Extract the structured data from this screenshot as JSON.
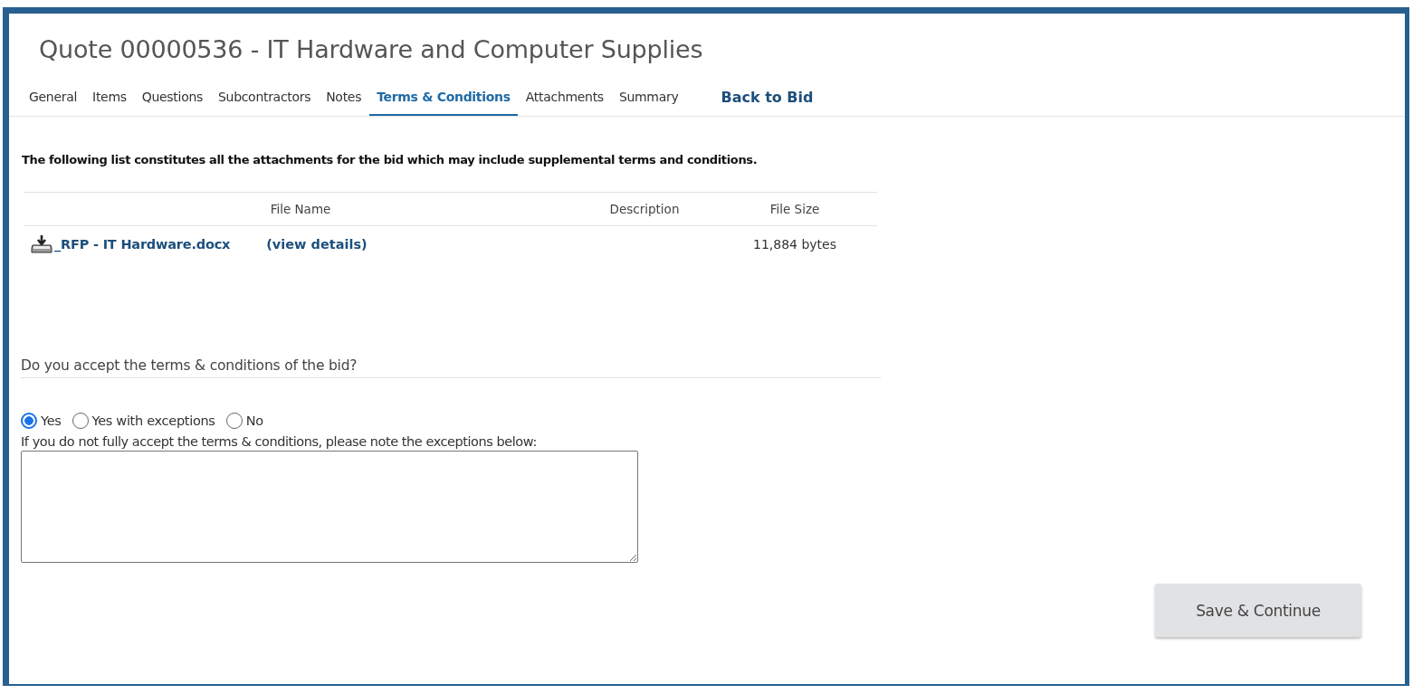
{
  "title": "Quote 00000536 - IT Hardware and Computer Supplies",
  "tabs": [
    {
      "label": "General",
      "kind": "tab",
      "selected": false
    },
    {
      "label": "Items",
      "kind": "tab",
      "selected": false
    },
    {
      "label": "Questions",
      "kind": "tab",
      "selected": false
    },
    {
      "label": "Subcontractors",
      "kind": "tab",
      "selected": false
    },
    {
      "label": "Notes",
      "kind": "tab",
      "selected": false
    },
    {
      "label": "Terms & Conditions",
      "kind": "tab",
      "selected": true
    },
    {
      "label": "Attachments",
      "kind": "tab",
      "selected": false
    },
    {
      "label": "Summary",
      "kind": "tab",
      "selected": false
    },
    {
      "label": "Back to Bid",
      "kind": "link",
      "selected": false
    }
  ],
  "intro": "The following list constitutes all the attachments for the bid which may include supplemental terms and conditions.",
  "attachments": {
    "columns": [
      "File Name",
      "Description",
      "File Size"
    ],
    "rows": [
      {
        "file_name": "_RFP - IT Hardware.docx",
        "details_link": "(view details)",
        "file_size": "11,884 bytes"
      }
    ]
  },
  "question": "Do you accept the terms & conditions of the bid?",
  "options": [
    {
      "label": "Yes",
      "selected": true
    },
    {
      "label": "Yes with exceptions",
      "selected": false
    },
    {
      "label": "No",
      "selected": false
    }
  ],
  "exceptions_label": "If you do not fully accept the terms & conditions, please note the exceptions below:",
  "save_button": "Save & Continue"
}
